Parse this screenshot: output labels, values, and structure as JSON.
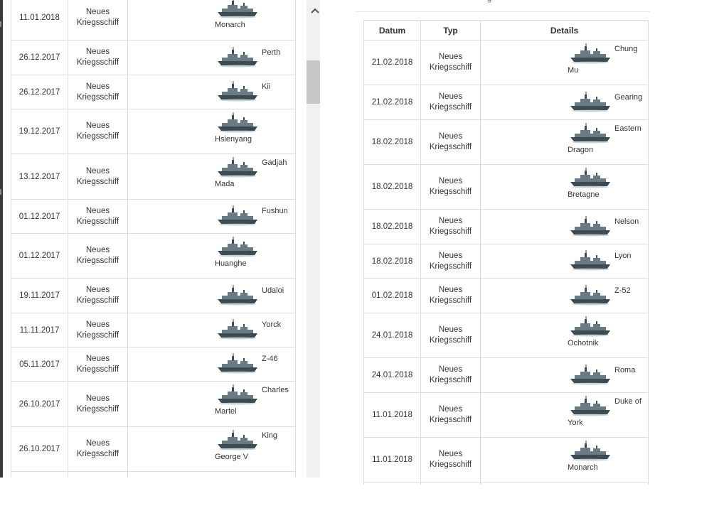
{
  "header": {
    "title_fragment": "g"
  },
  "table_headers": {
    "date": "Datum",
    "type": "Typ",
    "details": "Details"
  },
  "left_rows": [
    {
      "date": "11.01.2018",
      "type": "Neues\nKriegsschiff",
      "name_right": "",
      "name_below": "Monarch"
    },
    {
      "date": "26.12.2017",
      "type": "Neues\nKriegsschiff",
      "name_right": "Perth",
      "name_below": ""
    },
    {
      "date": "26.12.2017",
      "type": "Neues\nKriegsschiff",
      "name_right": "Kii",
      "name_below": ""
    },
    {
      "date": "19.12.2017",
      "type": "Neues\nKriegsschiff",
      "name_right": "",
      "name_below": "Hsienyang"
    },
    {
      "date": "13.12.2017",
      "type": "Neues\nKriegsschiff",
      "name_right": "Gadjah",
      "name_below": "Mada"
    },
    {
      "date": "01.12.2017",
      "type": "Neues\nKriegsschiff",
      "name_right": "Fushun",
      "name_below": ""
    },
    {
      "date": "01.12.2017",
      "type": "Neues\nKriegsschiff",
      "name_right": "",
      "name_below": "Huanghe"
    },
    {
      "date": "19.11.2017",
      "type": "Neues\nKriegsschiff",
      "name_right": "Udaloi",
      "name_below": ""
    },
    {
      "date": "11.11.2017",
      "type": "Neues\nKriegsschiff",
      "name_right": "Yorck",
      "name_below": ""
    },
    {
      "date": "05.11.2017",
      "type": "Neues\nKriegsschiff",
      "name_right": "Z-46",
      "name_below": ""
    },
    {
      "date": "26.10.2017",
      "type": "Neues\nKriegsschiff",
      "name_right": "Charles",
      "name_below": "Martel"
    },
    {
      "date": "26.10.2017",
      "type": "Neues\nKriegsschiff",
      "name_right": "King",
      "name_below": "George V"
    }
  ],
  "right_rows": [
    {
      "date": "21.02.2018",
      "type": "Neues\nKriegsschiff",
      "name_right": "Chung",
      "name_below": "Mu"
    },
    {
      "date": "21.02.2018",
      "type": "Neues\nKriegsschiff",
      "name_right": "Gearing",
      "name_below": ""
    },
    {
      "date": "18.02.2018",
      "type": "Neues\nKriegsschiff",
      "name_right": "Eastern",
      "name_below": "Dragon"
    },
    {
      "date": "18.02.2018",
      "type": "Neues\nKriegsschiff",
      "name_right": "",
      "name_below": "Bretagne"
    },
    {
      "date": "18.02.2018",
      "type": "Neues\nKriegsschiff",
      "name_right": "Nelson",
      "name_below": ""
    },
    {
      "date": "18.02.2018",
      "type": "Neues\nKriegsschiff",
      "name_right": "Lyon",
      "name_below": ""
    },
    {
      "date": "01.02.2018",
      "type": "Neues\nKriegsschiff",
      "name_right": "Z-52",
      "name_below": ""
    },
    {
      "date": "24.01.2018",
      "type": "Neues\nKriegsschiff",
      "name_right": "",
      "name_below": "Ochotnik"
    },
    {
      "date": "24.01.2018",
      "type": "Neues\nKriegsschiff",
      "name_right": "Roma",
      "name_below": ""
    },
    {
      "date": "11.01.2018",
      "type": "Neues\nKriegsschiff",
      "name_right": "Duke of",
      "name_below": "York"
    },
    {
      "date": "11.01.2018",
      "type": "Neues\nKriegsschiff",
      "name_right": "",
      "name_below": "Monarch"
    }
  ],
  "colors": {
    "border": "#dcdcdc",
    "text": "#333333",
    "scroll_thumb": "#c8c8c8",
    "scroll_track": "#f1f1f1",
    "ship_hull": "#6b7b86",
    "ship_dark": "#3e4a52"
  },
  "icons": {
    "ship": "warship-icon",
    "scroll_up": "chevron-up-icon"
  }
}
